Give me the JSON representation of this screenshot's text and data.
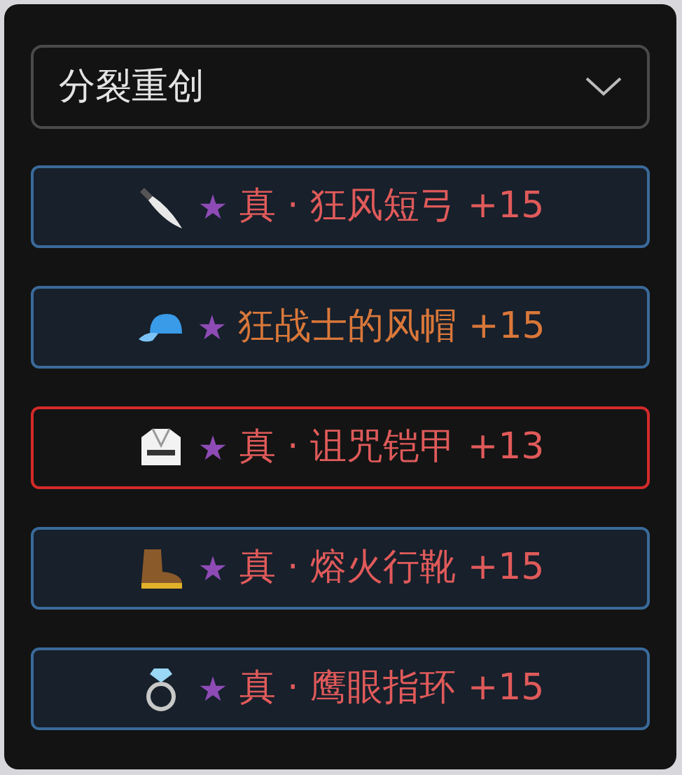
{
  "select": {
    "value": "分裂重创"
  },
  "items": [
    {
      "kind": "weapon",
      "star": "★",
      "name": "真 · 狂风短弓 +15",
      "color": "#e05a5a",
      "selected": false
    },
    {
      "kind": "helmet",
      "star": "★",
      "name": "狂战士的风帽 +15",
      "color": "#d9773a",
      "selected": false
    },
    {
      "kind": "armor",
      "star": "★",
      "name": "真 · 诅咒铠甲 +13",
      "color": "#e05a5a",
      "selected": true
    },
    {
      "kind": "boots",
      "star": "★",
      "name": "真 · 熔火行靴 +15",
      "color": "#e05a5a",
      "selected": false
    },
    {
      "kind": "ring",
      "star": "★",
      "name": "真 · 鹰眼指环 +15",
      "color": "#e05a5a",
      "selected": false
    }
  ]
}
